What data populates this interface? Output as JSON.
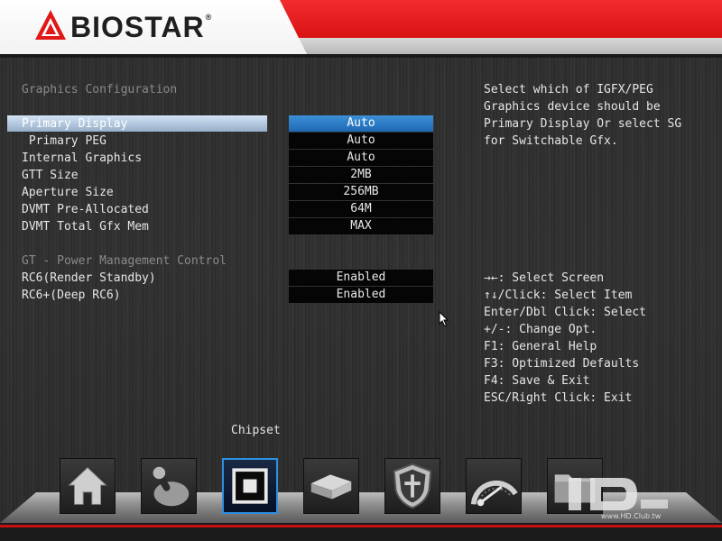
{
  "brand": {
    "name": "BIOSTAR",
    "trademark": "®"
  },
  "main": {
    "section_graphics": "Graphics Configuration",
    "items": [
      {
        "label": "Primary Display",
        "value": "Auto"
      },
      {
        "label": " Primary PEG",
        "value": "Auto"
      },
      {
        "label": "Internal Graphics",
        "value": "Auto"
      },
      {
        "label": "GTT Size",
        "value": "2MB"
      },
      {
        "label": "Aperture Size",
        "value": "256MB"
      },
      {
        "label": "DVMT Pre-Allocated",
        "value": "64M"
      },
      {
        "label": "DVMT Total Gfx Mem",
        "value": "MAX"
      }
    ],
    "section_power": "GT - Power Management Control",
    "power_items": [
      {
        "label": "RC6(Render Standby)",
        "value": "Enabled"
      },
      {
        "label": "RC6+(Deep RC6)",
        "value": "Enabled"
      }
    ]
  },
  "help": {
    "description": [
      "Select which of IGFX/PEG",
      "Graphics device should be",
      "Primary Display Or select SG",
      "for Switchable Gfx."
    ],
    "keys": [
      "→←: Select Screen",
      "↑↓/Click: Select Item",
      "Enter/Dbl Click: Select",
      "+/-: Change Opt.",
      "F1: General Help",
      "F3: Optimized Defaults",
      "F4: Save & Exit",
      "ESC/Right Click: Exit"
    ]
  },
  "dock": {
    "active_label": "Chipset",
    "icons": [
      "home-icon",
      "joystick-icon",
      "chip-icon",
      "drive-icon",
      "shield-icon",
      "gauge-icon",
      "folder-icon"
    ]
  },
  "watermark": {
    "text": "www.HD.Club.tw",
    "label": "HD CLUB"
  },
  "colors": {
    "accent_red": "#e01818",
    "selection_blue": "#2a7cc8",
    "background": "#2d2d2d"
  }
}
